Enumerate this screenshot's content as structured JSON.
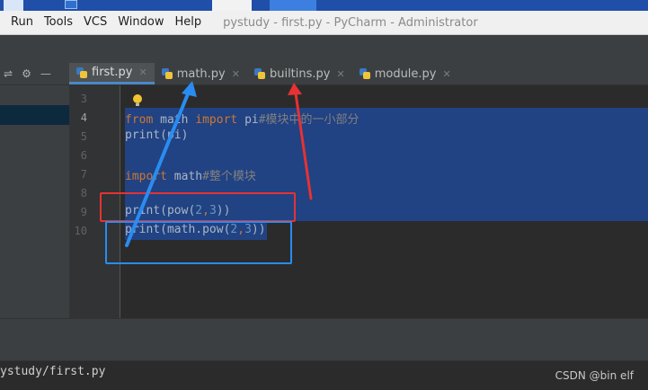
{
  "menu": {
    "items": [
      "Run",
      "Tools",
      "VCS",
      "Window",
      "Help"
    ],
    "title": "pystudy - first.py - PyCharm - Administrator"
  },
  "tabs": [
    {
      "label": "first.py",
      "active": true
    },
    {
      "label": "math.py",
      "active": false
    },
    {
      "label": "builtins.py",
      "active": false
    },
    {
      "label": "module.py",
      "active": false
    }
  ],
  "editor": {
    "line_numbers": [
      "3",
      "4",
      "5",
      "6",
      "7",
      "8",
      "9",
      "10"
    ],
    "lines": {
      "l4": {
        "kw1": "from",
        "mod": " math ",
        "kw2": "import",
        "name": " pi",
        "comment": "#模块中的一小部分"
      },
      "l5": {
        "text": "print(pi)"
      },
      "l7": {
        "kw": "import",
        "mod": " math",
        "comment": "#整个模块"
      },
      "l9": {
        "a": "print(pow(",
        "n1": "2",
        "c": ",",
        "n2": "3",
        "b": "))"
      },
      "l10": {
        "a": "print(math.pow(",
        "n1": "2",
        "c": ",",
        "n2": "3",
        "b": "))"
      }
    }
  },
  "status": {
    "run_path": "ystudy/first.py",
    "watermark": "CSDN @bin elf"
  },
  "colors": {
    "annotation_red": "#e53232",
    "annotation_blue": "#2a8cf0",
    "selection": "#214283"
  }
}
